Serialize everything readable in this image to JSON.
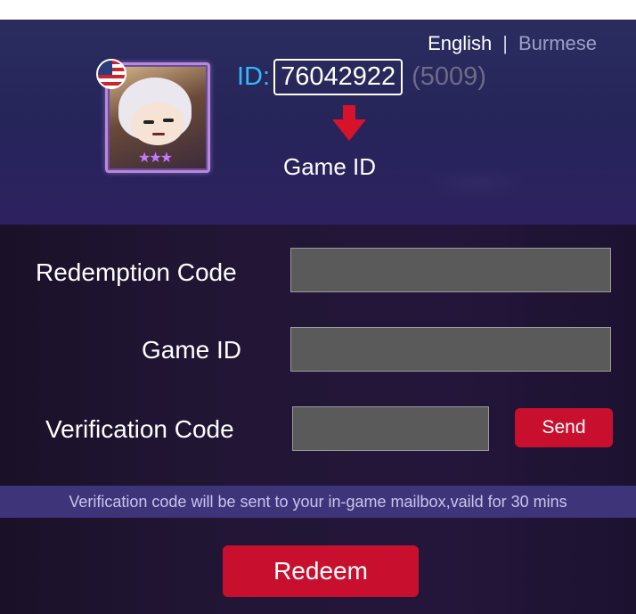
{
  "language": {
    "english": "English",
    "separator": "|",
    "burmese": "Burmese"
  },
  "profile": {
    "id_label": "ID:",
    "id_value": "76042922",
    "server": "(5009)",
    "hint_label": "Game ID",
    "avatar_stars": "★★★",
    "flag": "us-flag-icon"
  },
  "form": {
    "redemption_label": "Redemption Code",
    "redemption_value": "",
    "game_id_label": "Game ID",
    "game_id_value": "",
    "verification_label": "Verification Code",
    "verification_value": "",
    "send_label": "Send"
  },
  "notice": "Verification code will be sent to your in-game mailbox,vaild for 30 mins",
  "redeem_label": "Redeem",
  "colors": {
    "accent_red": "#c8102e",
    "id_blue": "#33b7ff",
    "header_bg": "#2a2c5e"
  }
}
